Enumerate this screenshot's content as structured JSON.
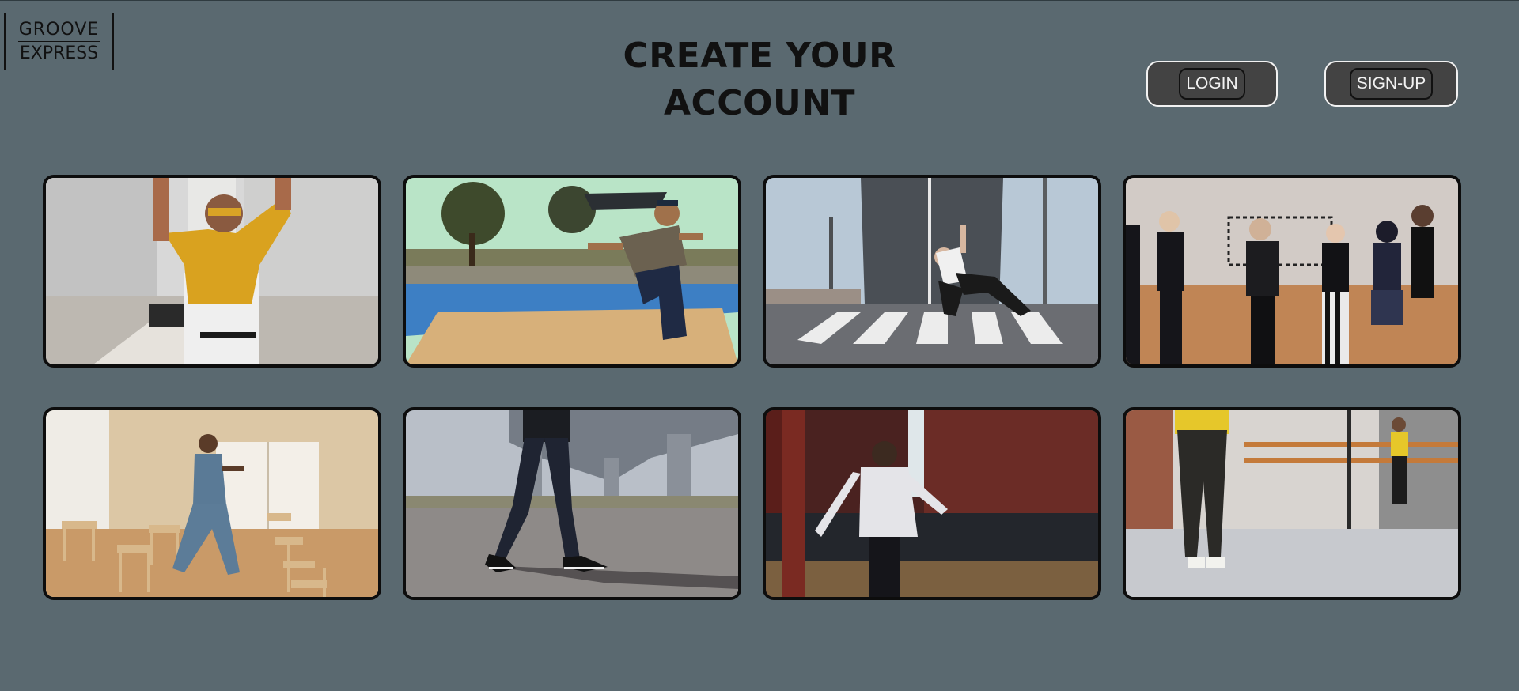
{
  "logo": {
    "line1": "GROOVE",
    "line2": "EXPRESS"
  },
  "page": {
    "title": "CREATE YOUR ACCOUNT"
  },
  "nav": {
    "login_label": "LOGIN",
    "signup_label": "SIGN-UP"
  },
  "colors": {
    "background": "#5a6970",
    "button_fill": "#434343",
    "button_border": "#f2f2f2",
    "title_text": "#111111"
  },
  "gallery": {
    "items": [
      {
        "id": "dancer-yellow-shirt"
      },
      {
        "id": "dancer-skatepark"
      },
      {
        "id": "dancer-bridge-breakdance"
      },
      {
        "id": "dancers-group-gym"
      },
      {
        "id": "dancer-hall-chairs"
      },
      {
        "id": "dancer-sneakers-overpass"
      },
      {
        "id": "dancer-red-curtain-room"
      },
      {
        "id": "dancer-ballet-studio"
      }
    ]
  }
}
